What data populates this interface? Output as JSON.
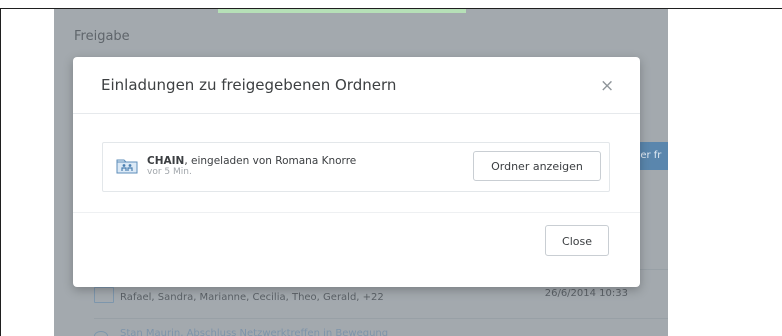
{
  "app": {
    "section_title": "Freigabe",
    "cut_button_text": "uer fr",
    "shared_row": {
      "members": "Rafael, Sandra, Marianne, Cecilia, Theo, Gerald, +22",
      "date": "26/6/2014 10:33"
    },
    "next_row_text": "Stan Maurin, Abschluss Netzwerktreffen in Bewegung"
  },
  "modal": {
    "title": "Einladungen zu freigegebenen Ordnern",
    "close_icon": "×",
    "invite": {
      "folder": "CHAIN",
      "invited_by": ", eingeladen von Romana Knorre",
      "time": "vor 5 Min.",
      "icon": "shared-folder-icon"
    },
    "open_button": "Ordner anzeigen",
    "close_button": "Close"
  },
  "colors": {
    "overlay": "#a3a9ae",
    "accent": "#5a86ad",
    "progress": "#b6e0b7"
  }
}
